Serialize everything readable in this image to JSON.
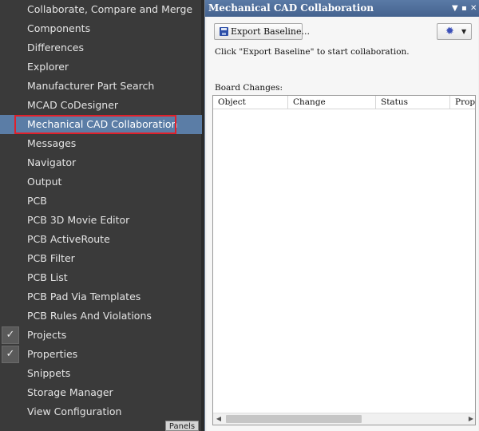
{
  "menu": {
    "items": [
      {
        "label": "Collaborate, Compare and Merge"
      },
      {
        "label": "Components"
      },
      {
        "label": "Differences"
      },
      {
        "label": "Explorer"
      },
      {
        "label": "Manufacturer Part Search"
      },
      {
        "label": "MCAD CoDesigner"
      },
      {
        "label": "Mechanical CAD Collaboration",
        "selected": true
      },
      {
        "label": "Messages"
      },
      {
        "label": "Navigator"
      },
      {
        "label": "Output"
      },
      {
        "label": "PCB"
      },
      {
        "label": "PCB 3D Movie Editor"
      },
      {
        "label": "PCB ActiveRoute"
      },
      {
        "label": "PCB Filter"
      },
      {
        "label": "PCB List"
      },
      {
        "label": "PCB Pad Via Templates"
      },
      {
        "label": "PCB Rules And Violations"
      },
      {
        "label": "Projects",
        "checked": true
      },
      {
        "label": "Properties",
        "checked": true
      },
      {
        "label": "Snippets"
      },
      {
        "label": "Storage Manager"
      },
      {
        "label": "View Configuration"
      }
    ],
    "panels_tab": "Panels",
    "check_glyph": "✓"
  },
  "panel": {
    "title": "Mechanical CAD Collaboration",
    "titlebar_icons": {
      "dropdown": "▼",
      "pin": "▪",
      "close": "✕"
    },
    "export_button": "Export Baseline...",
    "settings_icon": "gear-icon",
    "instruction": "Click \"Export Baseline\" to start collaboration.",
    "board_changes_label": "Board Changes:",
    "columns": [
      "Object",
      "Change",
      "Status",
      "Propo"
    ],
    "rows": []
  },
  "colors": {
    "menu_bg": "#3a3a3a",
    "selected_bg": "#5b7da6",
    "highlight_border": "#e0202a",
    "titlebar": "#4f6f9c"
  }
}
